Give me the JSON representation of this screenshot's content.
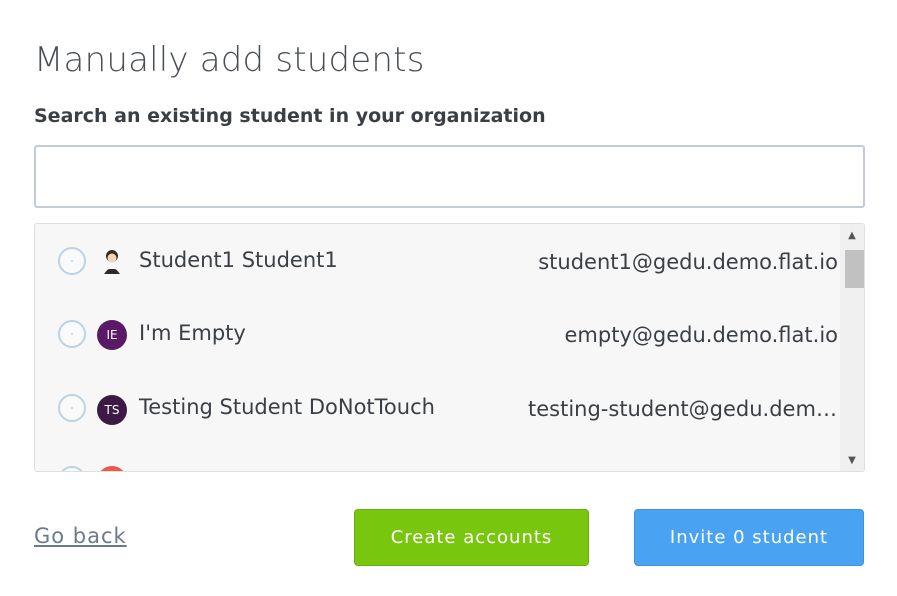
{
  "page": {
    "title": "Manually add students",
    "subtitle": "Search an existing student in your organization"
  },
  "search": {
    "value": "",
    "placeholder": ""
  },
  "students": [
    {
      "name": "Student1 Student1",
      "email": "student1@gedu.demo.flat.io",
      "avatar": "student-photo-icon",
      "initials": "",
      "avatar_color": "#f7f7f7"
    },
    {
      "name": "I'm Empty",
      "email": "empty@gedu.demo.flat.io",
      "avatar": "initials",
      "initials": "IE",
      "avatar_color": "#5b1a66"
    },
    {
      "name": "Testing Student DoNotTouch",
      "email": "testing-student@gedu.demo.flat.io",
      "avatar": "initials",
      "initials": "TS",
      "avatar_color": "#3c1a44"
    }
  ],
  "actions": {
    "go_back": "Go back",
    "create_accounts": "Create accounts",
    "invite": "Invite 0 student"
  },
  "colors": {
    "create_accent": "#79c60f",
    "invite_accent": "#4aa3f2",
    "radio_border": "#b9d3ea"
  }
}
